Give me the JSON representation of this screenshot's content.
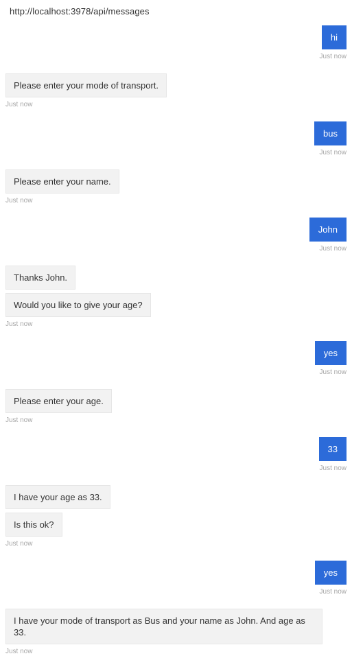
{
  "header": {
    "endpoint_url": "http://localhost:3978/api/messages"
  },
  "theme": {
    "user_bubble_bg": "#2c6bd9",
    "user_bubble_text": "#ffffff",
    "bot_bubble_bg": "#f2f2f2",
    "bot_bubble_border": "#e6e6e6",
    "bot_bubble_text": "#333333",
    "timestamp_color": "#a6a6a6",
    "page_bg": "#ffffff"
  },
  "conversation": {
    "groups": [
      {
        "sender": "user",
        "timestamp": "Just now",
        "bubbles": [
          "hi"
        ]
      },
      {
        "sender": "bot",
        "timestamp": "Just now",
        "bubbles": [
          "Please enter your mode of transport."
        ]
      },
      {
        "sender": "user",
        "timestamp": "Just now",
        "bubbles": [
          "bus"
        ]
      },
      {
        "sender": "bot",
        "timestamp": "Just now",
        "bubbles": [
          "Please enter your name."
        ]
      },
      {
        "sender": "user",
        "timestamp": "Just now",
        "bubbles": [
          "John"
        ]
      },
      {
        "sender": "bot",
        "timestamp": "Just now",
        "bubbles": [
          "Thanks John.",
          "Would you like to give your age?"
        ]
      },
      {
        "sender": "user",
        "timestamp": "Just now",
        "bubbles": [
          "yes"
        ]
      },
      {
        "sender": "bot",
        "timestamp": "Just now",
        "bubbles": [
          "Please enter your age."
        ]
      },
      {
        "sender": "user",
        "timestamp": "Just now",
        "bubbles": [
          "33"
        ]
      },
      {
        "sender": "bot",
        "timestamp": "Just now",
        "bubbles": [
          "I have your age as 33.",
          "Is this ok?"
        ]
      },
      {
        "sender": "user",
        "timestamp": "Just now",
        "bubbles": [
          "yes"
        ]
      },
      {
        "sender": "bot",
        "timestamp": "Just now",
        "bubbles": [
          "I have your mode of transport as Bus and your name as John. And age as 33."
        ]
      }
    ]
  }
}
